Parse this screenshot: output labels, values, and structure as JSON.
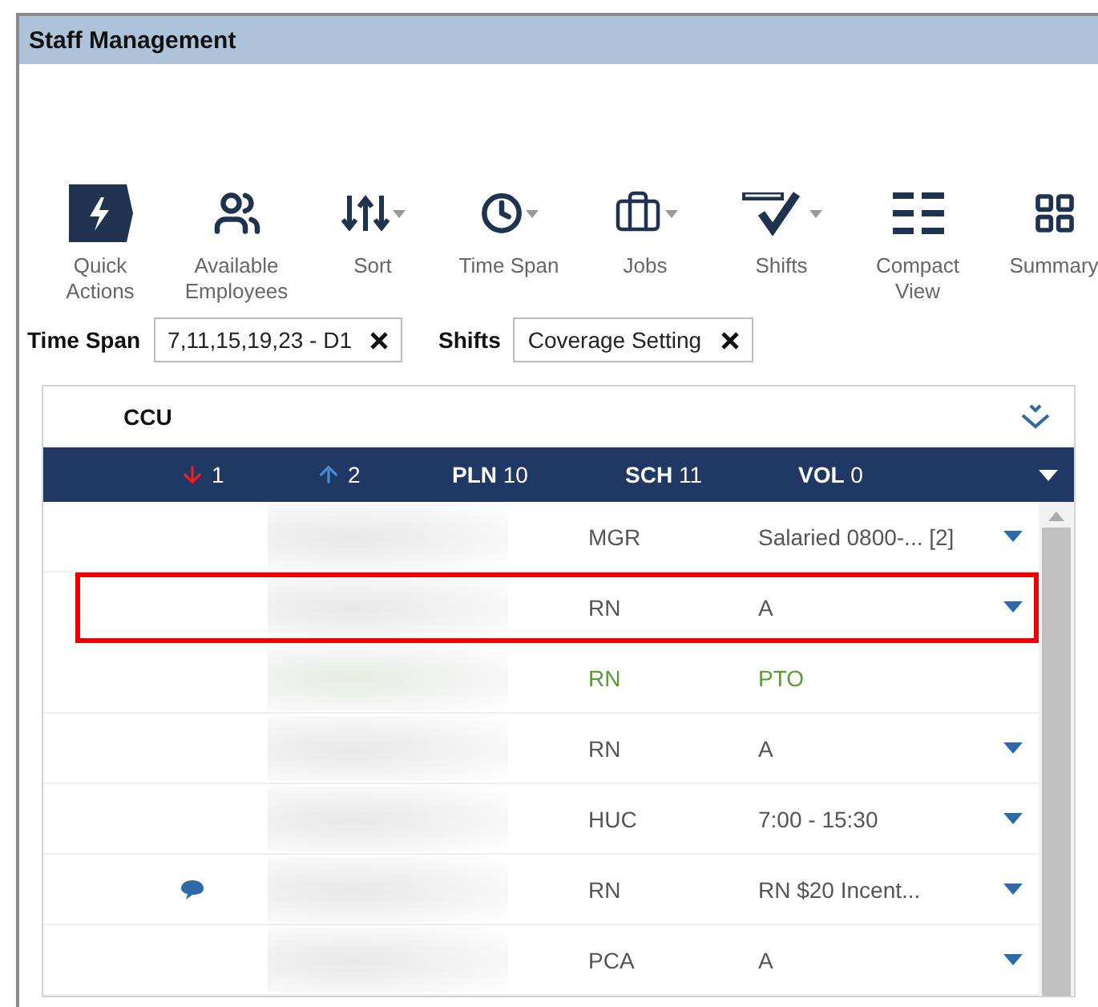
{
  "window": {
    "title": "Staff Management"
  },
  "toolbar": [
    {
      "kind": "quick",
      "label": "Quick Actions",
      "has_menu": false
    },
    {
      "kind": "people",
      "label": "Available Employees",
      "has_menu": false
    },
    {
      "kind": "sort",
      "label": "Sort",
      "has_menu": true
    },
    {
      "kind": "clock",
      "label": "Time Span",
      "has_menu": true
    },
    {
      "kind": "briefcase",
      "label": "Jobs",
      "has_menu": true
    },
    {
      "kind": "check",
      "label": "Shifts",
      "has_menu": true
    },
    {
      "kind": "compact",
      "label": "Compact View",
      "has_menu": false
    },
    {
      "kind": "grid",
      "label": "Summary",
      "has_menu": false
    }
  ],
  "filters": [
    {
      "label": "Time Span",
      "value": "7,11,15,19,23 - D1"
    },
    {
      "label": "Shifts",
      "value": "Coverage Setting"
    }
  ],
  "unit": {
    "name": "CCU"
  },
  "stats": [
    {
      "kind": "down",
      "label": "1"
    },
    {
      "kind": "up",
      "label": "2"
    },
    {
      "kind": "count",
      "label": "PLN",
      "value": "10"
    },
    {
      "kind": "count",
      "label": "SCH",
      "value": "11"
    },
    {
      "kind": "count",
      "label": "VOL",
      "value": "0"
    }
  ],
  "rows": [
    {
      "comment": false,
      "role": "MGR",
      "shift": "Salaried 0800-...",
      "shift_count": "[2]",
      "on_leave": false,
      "dropdown": true,
      "highlighted": false
    },
    {
      "comment": false,
      "role": "RN",
      "shift": "A",
      "on_leave": false,
      "dropdown": true,
      "highlighted": true
    },
    {
      "comment": false,
      "role": "RN",
      "shift": "PTO",
      "on_leave": true,
      "dropdown": false,
      "highlighted": false
    },
    {
      "comment": false,
      "role": "RN",
      "shift": "A",
      "on_leave": false,
      "dropdown": true,
      "highlighted": false
    },
    {
      "comment": false,
      "role": "HUC",
      "shift": "7:00 - 15:30",
      "on_leave": false,
      "dropdown": true,
      "highlighted": false
    },
    {
      "comment": true,
      "role": "RN",
      "shift": "RN $20 Incent...",
      "on_leave": false,
      "dropdown": true,
      "highlighted": false
    },
    {
      "comment": false,
      "role": "PCA",
      "shift": "A",
      "on_leave": false,
      "dropdown": true,
      "highlighted": false
    }
  ]
}
